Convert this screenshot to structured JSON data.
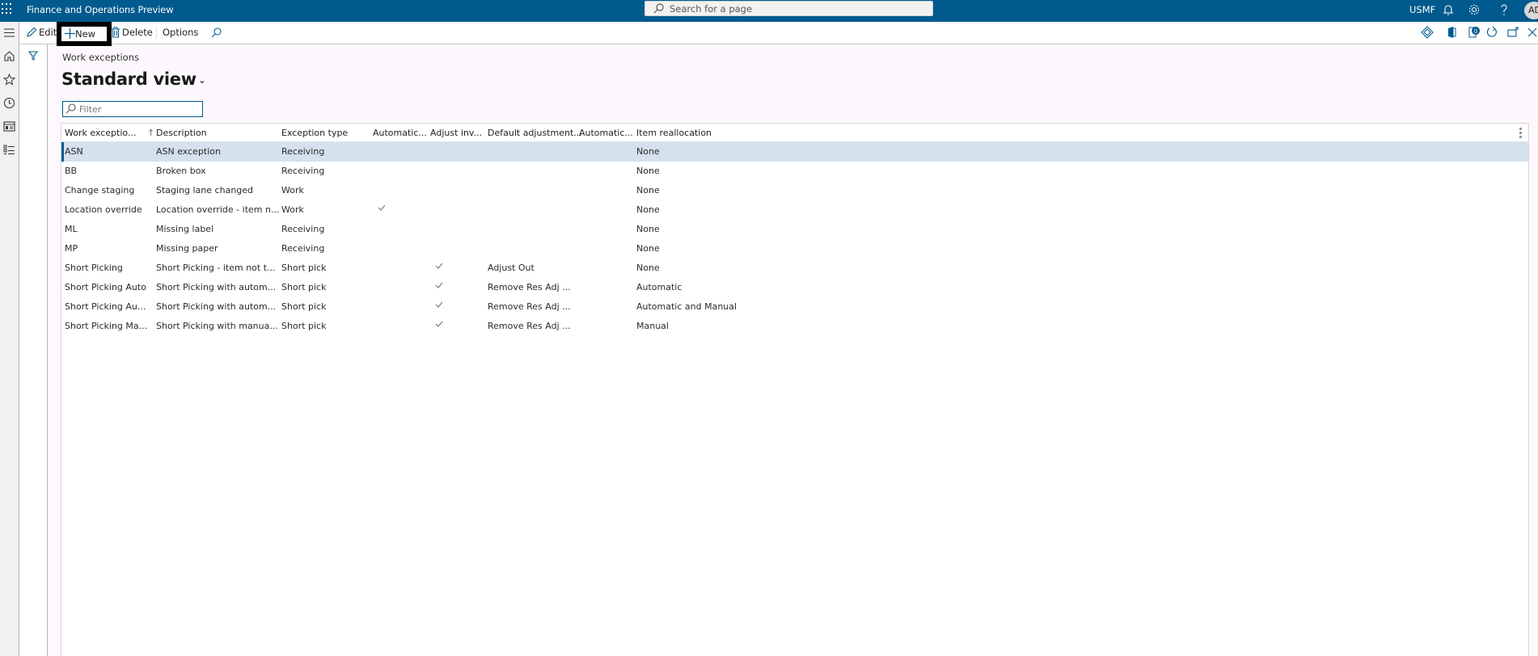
{
  "topbar": {
    "app_title": "Finance and Operations Preview",
    "search_placeholder": "Search for a page",
    "company": "USMF",
    "avatar_initials": "AD"
  },
  "actions": {
    "edit": "Edit",
    "new": "New",
    "delete": "Delete",
    "options": "Options"
  },
  "page": {
    "breadcrumb": "Work exceptions",
    "view_title": "Standard view",
    "filter_placeholder": "Filter"
  },
  "grid": {
    "columns": [
      "Work exceptio...",
      "Description",
      "Exception type",
      "Automatic...",
      "Adjust inv...",
      "Default adjustment...",
      "Automatic...",
      "Item reallocation"
    ],
    "sort_indicator": "↑",
    "rows": [
      {
        "code": "ASN",
        "description": "ASN exception",
        "type": "Receiving",
        "auto1": false,
        "adjust": false,
        "default_adj": "",
        "auto2": false,
        "realloc": "None",
        "selected": true
      },
      {
        "code": "BB",
        "description": "Broken box",
        "type": "Receiving",
        "auto1": false,
        "adjust": false,
        "default_adj": "",
        "auto2": false,
        "realloc": "None"
      },
      {
        "code": "Change staging",
        "description": "Staging lane changed",
        "type": "Work",
        "auto1": false,
        "adjust": false,
        "default_adj": "",
        "auto2": false,
        "realloc": "None"
      },
      {
        "code": "Location override",
        "description": "Location override - item n...",
        "type": "Work",
        "auto1": true,
        "adjust": false,
        "default_adj": "",
        "auto2": false,
        "realloc": "None"
      },
      {
        "code": "ML",
        "description": "Missing label",
        "type": "Receiving",
        "auto1": false,
        "adjust": false,
        "default_adj": "",
        "auto2": false,
        "realloc": "None"
      },
      {
        "code": "MP",
        "description": "Missing paper",
        "type": "Receiving",
        "auto1": false,
        "adjust": false,
        "default_adj": "",
        "auto2": false,
        "realloc": "None"
      },
      {
        "code": "Short Picking",
        "description": "Short Picking - item not t...",
        "type": "Short pick",
        "auto1": false,
        "adjust": true,
        "default_adj": "Adjust Out",
        "auto2": false,
        "realloc": "None"
      },
      {
        "code": "Short Picking Auto",
        "description": "Short Picking with autom...",
        "type": "Short pick",
        "auto1": false,
        "adjust": true,
        "default_adj": "Remove Res Adj ...",
        "auto2": false,
        "realloc": "Automatic"
      },
      {
        "code": "Short Picking Au...",
        "description": "Short Picking with autom...",
        "type": "Short pick",
        "auto1": false,
        "adjust": true,
        "default_adj": "Remove Res Adj ...",
        "auto2": false,
        "realloc": "Automatic and Manual"
      },
      {
        "code": "Short Picking Ma...",
        "description": "Short Picking with manua...",
        "type": "Short pick",
        "auto1": false,
        "adjust": true,
        "default_adj": "Remove Res Adj ...",
        "auto2": false,
        "realloc": "Manual"
      }
    ]
  },
  "icons": {
    "waffle": "app-launcher-icon",
    "bell": "notifications-icon",
    "gear": "settings-icon",
    "help": "help-icon"
  },
  "colors": {
    "brand": "#005a8e",
    "selected_row": "#d5e1ec",
    "page_bg": "#fdf8fd"
  }
}
